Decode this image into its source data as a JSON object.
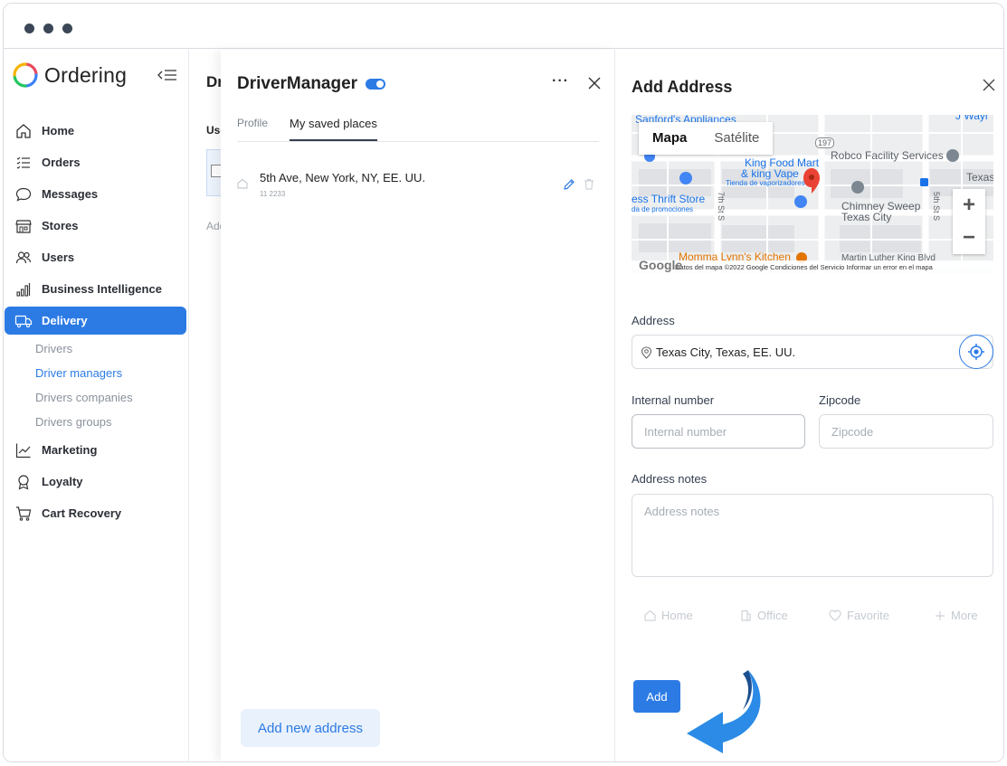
{
  "sidebar": {
    "brand": "Ordering",
    "items": [
      {
        "label": "Home",
        "icon": "home-icon"
      },
      {
        "label": "Orders",
        "icon": "list-icon"
      },
      {
        "label": "Messages",
        "icon": "chat-icon"
      },
      {
        "label": "Stores",
        "icon": "store-icon"
      },
      {
        "label": "Users",
        "icon": "users-icon"
      },
      {
        "label": "Business Intelligence",
        "icon": "bar-chart-icon"
      },
      {
        "label": "Delivery",
        "icon": "truck-icon"
      }
    ],
    "sub_items": [
      {
        "label": "Drivers"
      },
      {
        "label": "Driver managers"
      },
      {
        "label": "Drivers companies"
      },
      {
        "label": "Drivers groups"
      }
    ],
    "items_after": [
      {
        "label": "Marketing",
        "icon": "trend-icon"
      },
      {
        "label": "Loyalty",
        "icon": "award-icon"
      },
      {
        "label": "Cart Recovery",
        "icon": "cart-icon"
      }
    ]
  },
  "background_page": {
    "title": "Dr",
    "tab": "Use",
    "add": "Add"
  },
  "driver_manager": {
    "title": "DriverManager",
    "tabs": [
      "Profile",
      "My saved places"
    ],
    "place": {
      "name": "5th Ave, New York, NY, EE. UU.",
      "sub": "11 2233"
    },
    "add_new": "Add new address",
    "more": "···"
  },
  "add_address": {
    "title": "Add Address",
    "map": {
      "type_map": "Mapa",
      "type_sat": "Satélite",
      "labels": {
        "sanford": "Sanford's Appliances",
        "wayl": "J Wayl",
        "king_food": "King Food Mart",
        "king_vape": "& king Vape",
        "tienda": "Tienda de vaporizadores",
        "robco": "Robco Facility Services",
        "texas": "Texas",
        "thrift": "ess Thrift Store",
        "promo": "da de promociones",
        "chimney1": "Chimney Sweep",
        "chimney2": "Texas City",
        "momma": "Momma Lynn's Kitchen",
        "mlk": "Martin Luther King Blvd",
        "st7": "7th St S",
        "st5": "5th St S",
        "r197": "197",
        "google": "Google"
      },
      "footer": "Datos del mapa ©2022 Google    Condiciones del Servicio    Informar un error en el mapa"
    },
    "address_label": "Address",
    "address_value": "Texas City, Texas, EE. UU.",
    "internal_label": "Internal number",
    "internal_placeholder": "Internal number",
    "zip_label": "Zipcode",
    "zip_placeholder": "Zipcode",
    "notes_label": "Address notes",
    "notes_placeholder": "Address notes",
    "tags": [
      "Home",
      "Office",
      "Favorite",
      "More"
    ],
    "add_button": "Add"
  },
  "colors": {
    "accent": "#2c7be5",
    "pin": "#ea4335",
    "arrow": "#2b8be6"
  }
}
